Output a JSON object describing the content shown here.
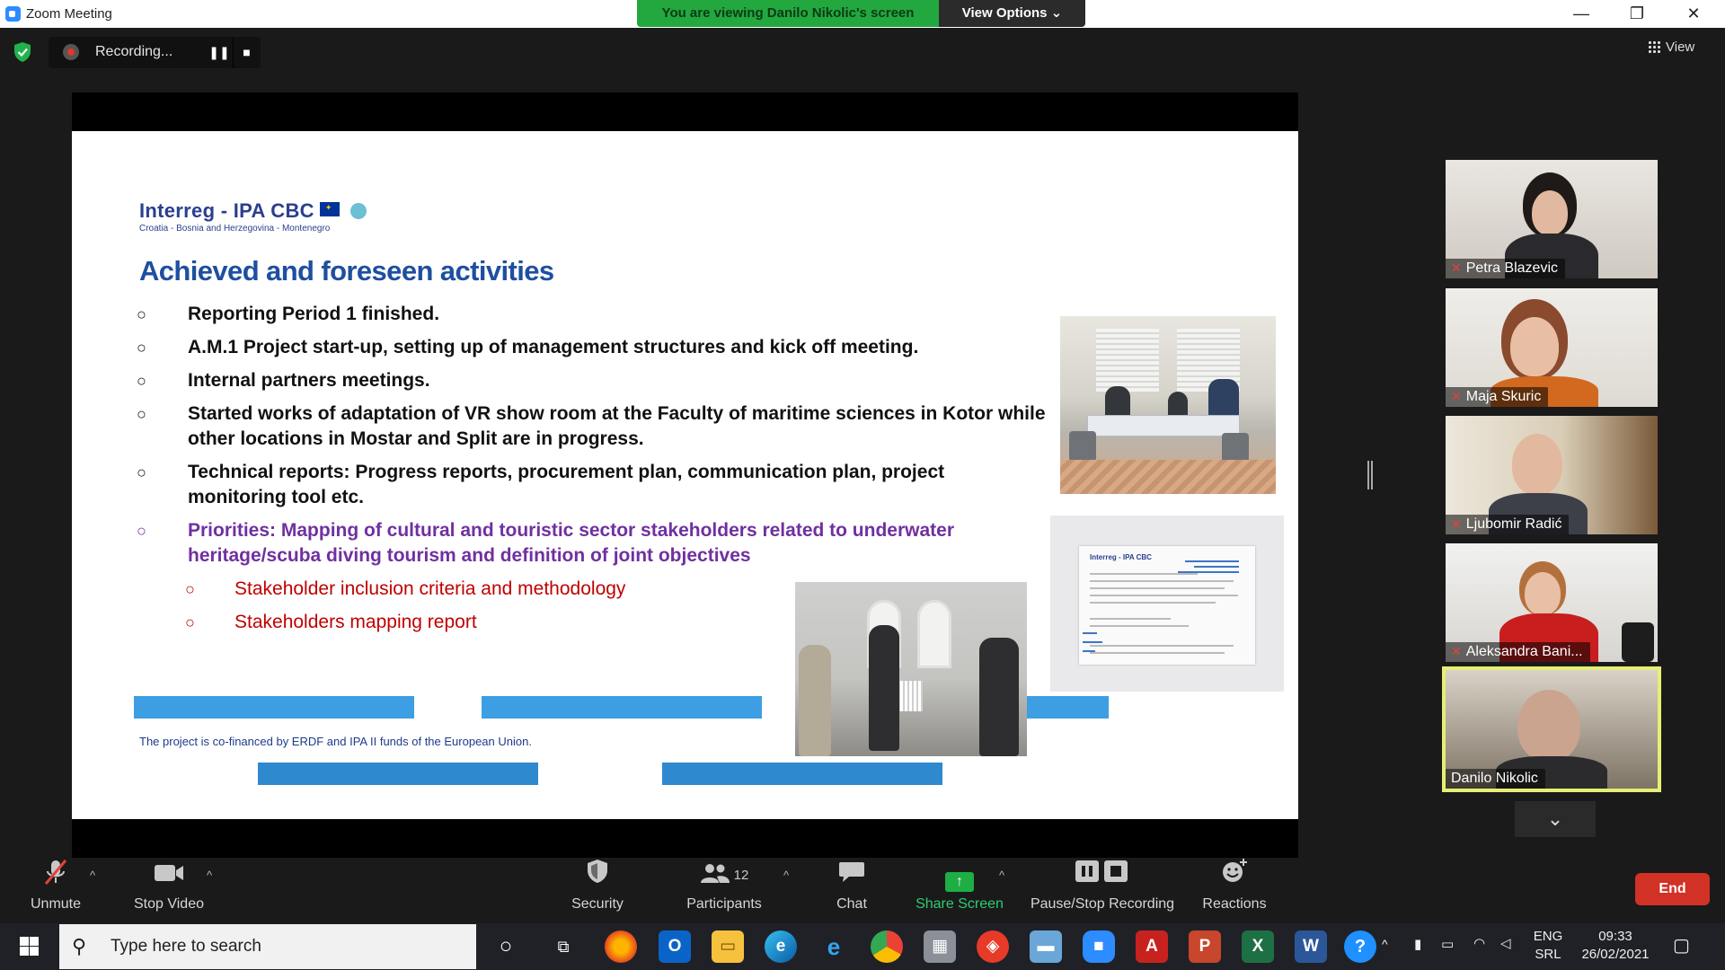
{
  "window": {
    "title": "Zoom Meeting",
    "minimize": "—",
    "restore": "❐",
    "close": "✕"
  },
  "banner": {
    "viewing": "You are viewing Danilo Nikolic's screen",
    "view_options": "View Options ⌄"
  },
  "recording": {
    "label": "Recording...",
    "pause": "❚❚",
    "stop": "■"
  },
  "view_button": "View",
  "slide": {
    "logo_main": "Interreg - IPA CBC",
    "logo_sub": "Croatia - Bosnia and Herzegovina - Montenegro",
    "title": "Achieved and foreseen activities",
    "bullet_mark": "○",
    "bullets": [
      "Reporting Period 1 finished.",
      "A.M.1 Project start-up, setting up of management structures and kick off meeting.",
      "Internal partners meetings.",
      "Started works of adaptation of VR show room at the Faculty of maritime sciences in Kotor while other locations in Mostar and Split are in progress.",
      "Technical reports: Progress reports, procurement plan, communication plan, project monitoring tool etc.",
      "Priorities: Mapping of cultural and touristic sector stakeholders related to underwater heritage/scuba diving tourism and definition of joint objectives"
    ],
    "sub_bullets": [
      "Stakeholder inclusion criteria and methodology",
      "Stakeholders mapping report"
    ],
    "cofinance": "The project is co-financed by ERDF and IPA II funds of the European Union.",
    "doc_head": "Interreg - IPA CBC"
  },
  "participants": [
    {
      "name": "Petra Blazevic",
      "muted": true
    },
    {
      "name": "Maja Skuric",
      "muted": true
    },
    {
      "name": "Ljubomir Radić",
      "muted": true
    },
    {
      "name": "Aleksandra Bani...",
      "muted": true
    },
    {
      "name": "Danilo Nikolic",
      "muted": false
    }
  ],
  "strip_chevron": "⌄",
  "controls": {
    "unmute": "Unmute",
    "stop_video": "Stop Video",
    "security": "Security",
    "participants": "Participants",
    "participants_count": "12",
    "chat": "Chat",
    "share_screen": "Share Screen",
    "pause_stop_recording": "Pause/Stop Recording",
    "reactions": "Reactions",
    "end": "End",
    "caret": "^"
  },
  "taskbar": {
    "search_placeholder": "Type here to search",
    "lang_top": "ENG",
    "lang_bottom": "SRL",
    "time": "09:33",
    "date": "26/02/2021"
  },
  "colors": {
    "zoom_blue": "#2d8cff",
    "banner_green": "#23a73f",
    "slide_title_blue": "#1e4fa0",
    "priority_purple": "#7030a0",
    "sub_red": "#c00000",
    "end_red": "#d23126",
    "active_speaker": "#e7ee74"
  }
}
